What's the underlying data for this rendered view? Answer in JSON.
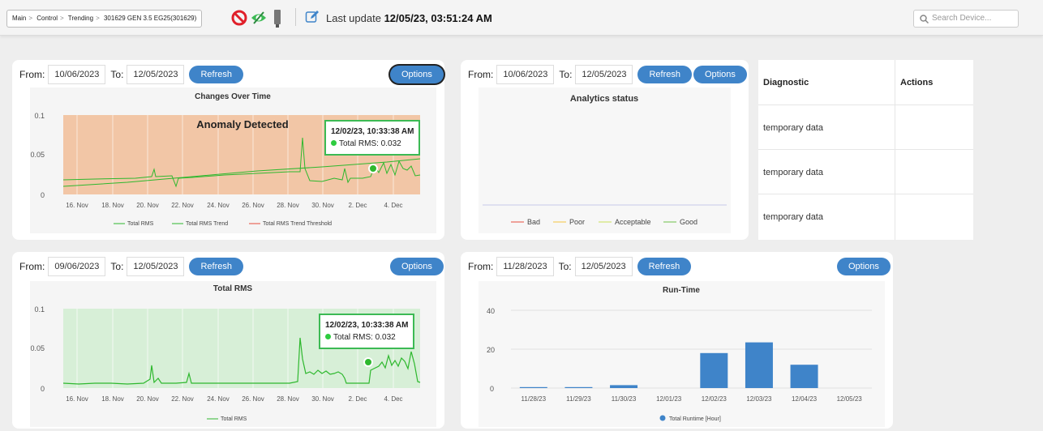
{
  "breadcrumb": [
    "Main",
    "Control",
    "Trending",
    "301629 GEN 3.5 EG25(301629)"
  ],
  "header": {
    "last_update_label": "Last update",
    "last_update_value": "12/05/23, 03:51:24 AM"
  },
  "search": {
    "placeholder": "Search Device..."
  },
  "icons": {
    "status": "ban-icon",
    "visibility": "eye-slash-icon",
    "device": "sensor-icon",
    "edit": "edit-icon"
  },
  "colors": {
    "accent": "#3f84c9",
    "anomaly": "#f2c6a6",
    "good_fill": "#d7efd7",
    "series": "#2eb82e"
  },
  "panels": {
    "changes": {
      "from_label": "From:",
      "from": "10/06/2023",
      "to_label": "To:",
      "to": "12/05/2023",
      "refresh": "Refresh",
      "options": "Options",
      "title": "Changes Over Time",
      "banner": "Anomaly Detected",
      "tooltip_date": "12/02/23, 10:33:38 AM",
      "tooltip_value": "Total RMS: 0.032",
      "legend": [
        "Total RMS",
        "Total RMS Trend",
        "Total RMS Trend Threshold"
      ]
    },
    "analytics": {
      "from_label": "From:",
      "from": "10/06/2023",
      "to_label": "To:",
      "to": "12/05/2023",
      "refresh": "Refresh",
      "options": "Options",
      "title": "Analytics status",
      "legend": [
        "Bad",
        "Poor",
        "Acceptable",
        "Good"
      ]
    },
    "totalrms": {
      "from_label": "From:",
      "from": "09/06/2023",
      "to_label": "To:",
      "to": "12/05/2023",
      "refresh": "Refresh",
      "options": "Options",
      "title": "Total RMS",
      "tooltip_date": "12/02/23, 10:33:38 AM",
      "tooltip_value": "Total RMS: 0.032",
      "legend": [
        "Total RMS"
      ]
    },
    "runtime": {
      "from_label": "From:",
      "from": "11/28/2023",
      "to_label": "To:",
      "to": "12/05/2023",
      "refresh": "Refresh",
      "options": "Options",
      "title": "Run-Time",
      "legend": [
        "Total Runtime [Hour]"
      ]
    }
  },
  "diagnostic_table": {
    "headers": [
      "Diagnostic",
      "Actions"
    ],
    "rows": [
      "temporary data",
      "temporary data",
      "temporary data"
    ]
  },
  "chart_data": [
    {
      "type": "line",
      "title": "Changes Over Time",
      "x_ticks": [
        "16. Nov",
        "18. Nov",
        "20. Nov",
        "22. Nov",
        "24. Nov",
        "26. Nov",
        "28. Nov",
        "30. Nov",
        "2. Dec",
        "4. Dec"
      ],
      "y_ticks": [
        "0",
        "0.05",
        "0.1"
      ],
      "ylim": [
        0,
        0.1
      ],
      "series": [
        {
          "name": "Total RMS"
        },
        {
          "name": "Total RMS Trend"
        },
        {
          "name": "Total RMS Trend Threshold"
        }
      ],
      "annotation": "Anomaly Detected"
    },
    {
      "type": "line",
      "title": "Total RMS",
      "x_ticks": [
        "16. Nov",
        "18. Nov",
        "20. Nov",
        "22. Nov",
        "24. Nov",
        "26. Nov",
        "28. Nov",
        "30. Nov",
        "2. Dec",
        "4. Dec"
      ],
      "y_ticks": [
        "0",
        "0.05",
        "0.1"
      ],
      "ylim": [
        0,
        0.1
      ],
      "series": [
        {
          "name": "Total RMS"
        }
      ]
    },
    {
      "type": "bar",
      "title": "Run-Time",
      "categories": [
        "11/28/23",
        "11/29/23",
        "11/30/23",
        "12/01/23",
        "12/02/23",
        "12/03/23",
        "12/04/23",
        "12/05/23"
      ],
      "values": [
        0.5,
        0.5,
        1.5,
        0,
        18,
        23.5,
        12,
        0
      ],
      "y_ticks": [
        "0",
        "20",
        "40"
      ],
      "ylim": [
        0,
        40
      ],
      "series": [
        {
          "name": "Total Runtime [Hour]"
        }
      ]
    }
  ]
}
